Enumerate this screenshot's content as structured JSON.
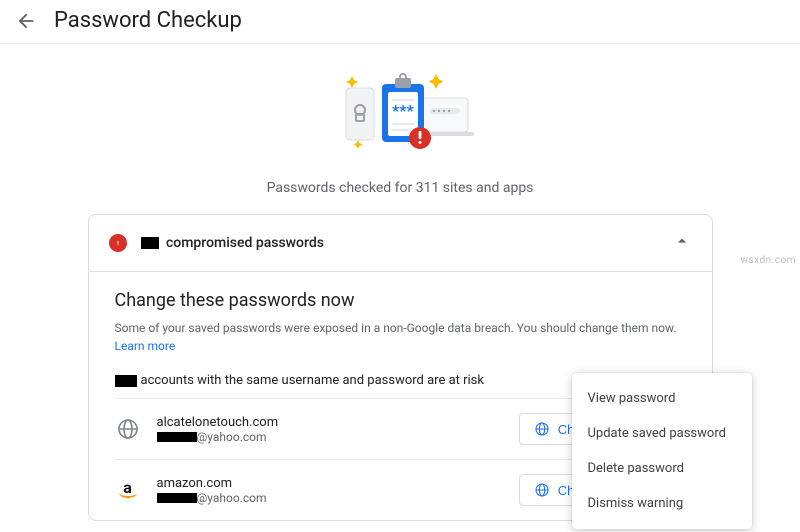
{
  "header": {
    "title": "Password Checkup"
  },
  "hero": {
    "caption": "Passwords checked for 311 sites and apps"
  },
  "compromised": {
    "title": " compromised passwords",
    "heading": "Change these passwords now",
    "desc": "Some of your saved passwords were exposed in a non-Google data breach. You should change them now. ",
    "learn_more": "Learn more",
    "subhead": "accounts with the same username and password are at risk",
    "change_btn": "Change password",
    "rows": [
      {
        "site": "alcatelonetouch.com",
        "email_domain": "@yahoo.com",
        "icon": "globe"
      },
      {
        "site": "amazon.com",
        "email_domain": "@yahoo.com",
        "icon": "amazon"
      }
    ]
  },
  "menu": {
    "view": "View password",
    "update": "Update saved password",
    "delete": "Delete password",
    "dismiss": "Dismiss warning"
  },
  "watermark": "wsxdn.com"
}
